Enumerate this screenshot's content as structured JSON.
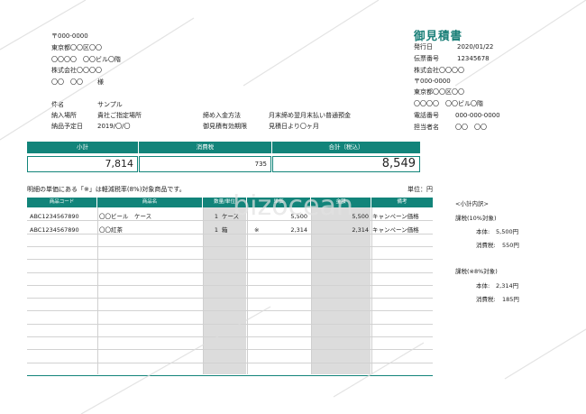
{
  "recipient": {
    "postal": "〒000-0000",
    "address": "東京都〇〇区〇〇",
    "building": "〇〇〇〇　〇〇ビル〇階",
    "company": "株式会社〇〇〇〇",
    "person": "〇〇　〇〇",
    "honorific": "様"
  },
  "doc": {
    "title": "御見積書",
    "issue_label": "発行日",
    "issue_value": "2020/01/22",
    "slip_label": "伝票番号",
    "slip_value": "12345678"
  },
  "issuer": {
    "company": "株式会社〇〇〇〇",
    "postal": "〒000-0000",
    "address": "東京都〇〇区〇〇",
    "building": "〇〇〇〇　〇〇ビル〇階",
    "tel_label": "電話番号",
    "tel_value": "000-000-0000",
    "staff_label": "担当者名",
    "staff_value": "〇〇　〇〇"
  },
  "info": {
    "subject_label": "件名",
    "subject_value": "サンプル",
    "place_label": "納入場所",
    "place_value": "貴社ご指定場所",
    "date_label": "納品予定日",
    "date_value": "2019/〇/〇",
    "payment_label": "締め入金方法",
    "payment_value": "月末締め翌月末払い普通預金",
    "validity_label": "御見積有効期限",
    "validity_value": "見積日より〇ヶ月"
  },
  "summary": {
    "subtotal_label": "小計",
    "subtotal_value": "7,814",
    "tax_label": "消費税",
    "tax_value": "735",
    "total_label": "合計（税込）",
    "total_value": "8,549"
  },
  "note": "明細の単価にある「※」は軽減税率(8%)対象商品です。",
  "unit_note": "単位：円",
  "table": {
    "headers": [
      "商品コード",
      "商品名",
      "数量/単位",
      "単価",
      "金額",
      "備考"
    ],
    "rows": [
      {
        "code": "ABC1234567890",
        "name": "〇〇ビール　ケース",
        "qty": "1",
        "unit": "ケース",
        "mark": "",
        "price": "5,500",
        "amount": "5,500",
        "remark": "キャンペーン価格"
      },
      {
        "code": "ABC1234567890",
        "name": "〇〇紅茶",
        "qty": "1",
        "unit": "箱",
        "mark": "※",
        "price": "2,314",
        "amount": "2,314",
        "remark": "キャンペーン価格"
      }
    ]
  },
  "breakdown": {
    "title": "<小計内訳>",
    "g10_title": "課税(10%対象)",
    "g10_base_label": "本体:",
    "g10_base_value": "5,500円",
    "g10_tax_label": "消費税:",
    "g10_tax_value": "550円",
    "g8_title": "課税(※8%対象)",
    "g8_base_label": "本体:",
    "g8_base_value": "2,314円",
    "g8_tax_label": "消費税:",
    "g8_tax_value": "185円"
  },
  "watermark": "bizocean"
}
